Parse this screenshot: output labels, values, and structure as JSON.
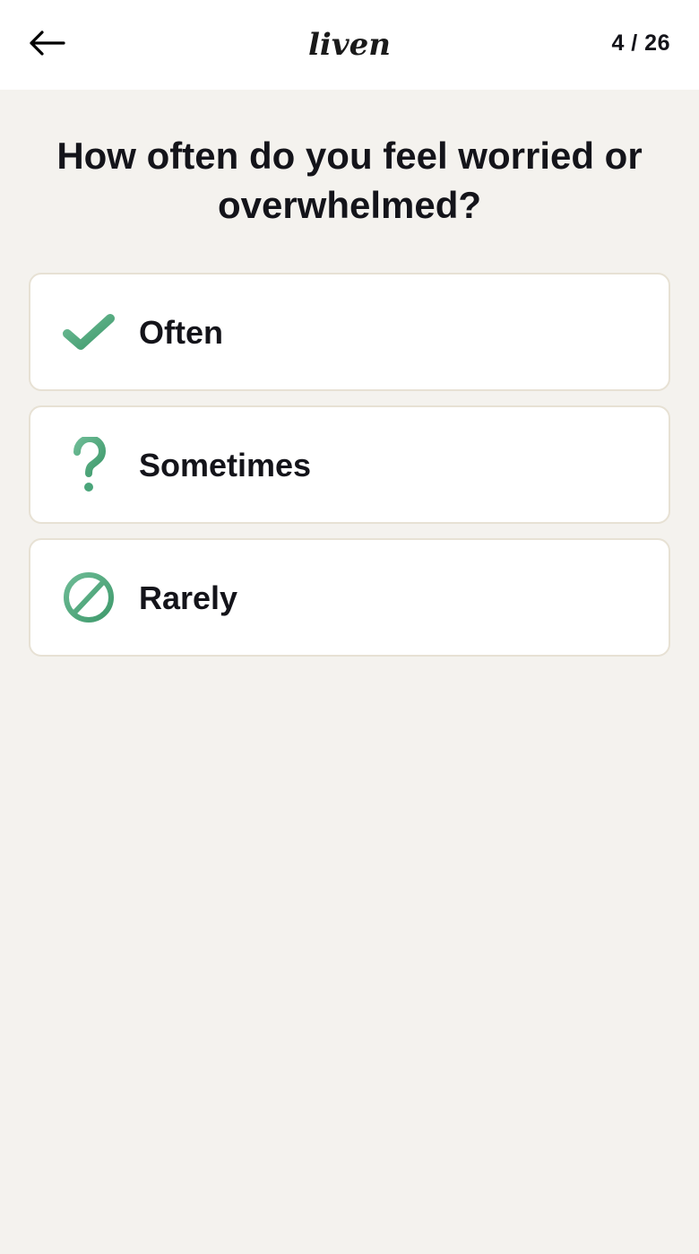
{
  "app": {
    "logo_text": "liven",
    "accent_color": "#4aa57a"
  },
  "header": {
    "back_icon": "arrow-left-icon",
    "progress": "4 / 26"
  },
  "question": {
    "title": "How often do you feel worried or overwhelmed?"
  },
  "options": [
    {
      "label": "Often",
      "icon": "checkmark-icon"
    },
    {
      "label": "Sometimes",
      "icon": "question-mark-icon"
    },
    {
      "label": "Rarely",
      "icon": "prohibited-icon"
    }
  ]
}
